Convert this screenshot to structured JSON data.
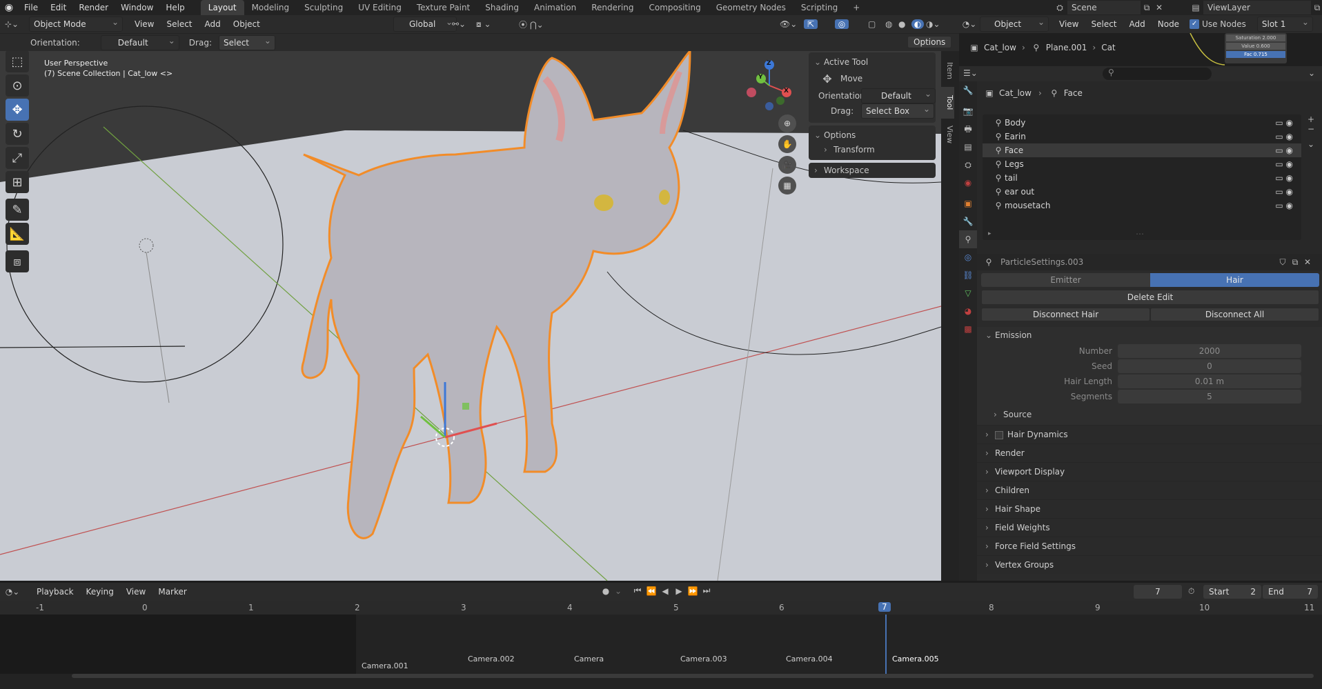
{
  "topbar": {
    "menus": [
      "File",
      "Edit",
      "Render",
      "Window",
      "Help"
    ],
    "workspaces": [
      "Layout",
      "Modeling",
      "Sculpting",
      "UV Editing",
      "Texture Paint",
      "Shading",
      "Animation",
      "Rendering",
      "Compositing",
      "Geometry Nodes",
      "Scripting"
    ],
    "active_workspace": "Layout",
    "add_tab": "+",
    "scene": "Scene",
    "view_layer": "ViewLayer"
  },
  "viewport_header": {
    "mode": "Object Mode",
    "menus": [
      "View",
      "Select",
      "Add",
      "Object"
    ],
    "transform_orientation": "Global",
    "options": "Options"
  },
  "tool_settings": {
    "orientation_label": "Orientation:",
    "orientation_value": "Default",
    "drag_label": "Drag:",
    "drag_value": "Select Box"
  },
  "viewport": {
    "perspective": "User Perspective",
    "collection": "(7) Scene Collection | Cat_low <>",
    "axis_x": "X",
    "axis_y": "Y",
    "axis_z": "Z"
  },
  "n_panel": {
    "tabs": [
      "Item",
      "Tool",
      "View"
    ],
    "active_tool_title": "Active Tool",
    "active_tool_name": "Move",
    "orientation_label": "Orientation",
    "orientation_value": "Default",
    "drag_label": "Drag:",
    "drag_value": "Select Box",
    "options_title": "Options",
    "transform_label": "Transform",
    "workspace_label": "Workspace"
  },
  "node_editor_header": {
    "editor_type": "Object",
    "menus": [
      "View",
      "Select",
      "Add",
      "Node"
    ],
    "use_nodes": "Use Nodes",
    "slot": "Slot 1",
    "breadcrumb_obj": "Cat_low",
    "breadcrumb_plane": "Plane.001",
    "breadcrumb_cat": "Cat",
    "mini_node_fields": [
      "Saturation 2.000",
      "Value 0.600",
      "Fac 0.715"
    ]
  },
  "outliner": {
    "breadcrumb_obj": "Cat_low",
    "breadcrumb_item": "Face",
    "items": [
      "Body",
      "Earin",
      "Face",
      "Legs",
      "tail",
      "ear out",
      "mousetach"
    ],
    "selected_item": "Face"
  },
  "properties": {
    "particle_settings": "ParticleSettings.003",
    "emitter_tab": "Emitter",
    "hair_tab": "Hair",
    "delete_edit": "Delete Edit",
    "disconnect_hair": "Disconnect Hair",
    "disconnect_all": "Disconnect All",
    "emission_title": "Emission",
    "emission_fields": [
      {
        "label": "Number",
        "value": "2000"
      },
      {
        "label": "Seed",
        "value": "0"
      },
      {
        "label": "Hair Length",
        "value": "0.01 m"
      },
      {
        "label": "Segments",
        "value": "5"
      }
    ],
    "source_label": "Source",
    "sections": [
      "Hair Dynamics",
      "Render",
      "Viewport Display",
      "Children",
      "Hair Shape",
      "Field Weights",
      "Force Field Settings",
      "Vertex Groups"
    ]
  },
  "timeline": {
    "menus": [
      "Playback",
      "Keying",
      "View",
      "Marker"
    ],
    "current_frame": "7",
    "start_label": "Start",
    "start_value": "2",
    "end_label": "End",
    "end_value": "7",
    "frame_numbers": [
      "-1",
      "0",
      "1",
      "2",
      "3",
      "4",
      "5",
      "6",
      "7",
      "8",
      "9",
      "10",
      "11"
    ],
    "markers": [
      "Camera.001",
      "Camera.002",
      "Camera",
      "Camera.003",
      "Camera.004",
      "Camera.005"
    ],
    "colors": {
      "playhead": "#4772b3",
      "accent": "#4772b3",
      "selection_outline": "#f28c28"
    }
  }
}
